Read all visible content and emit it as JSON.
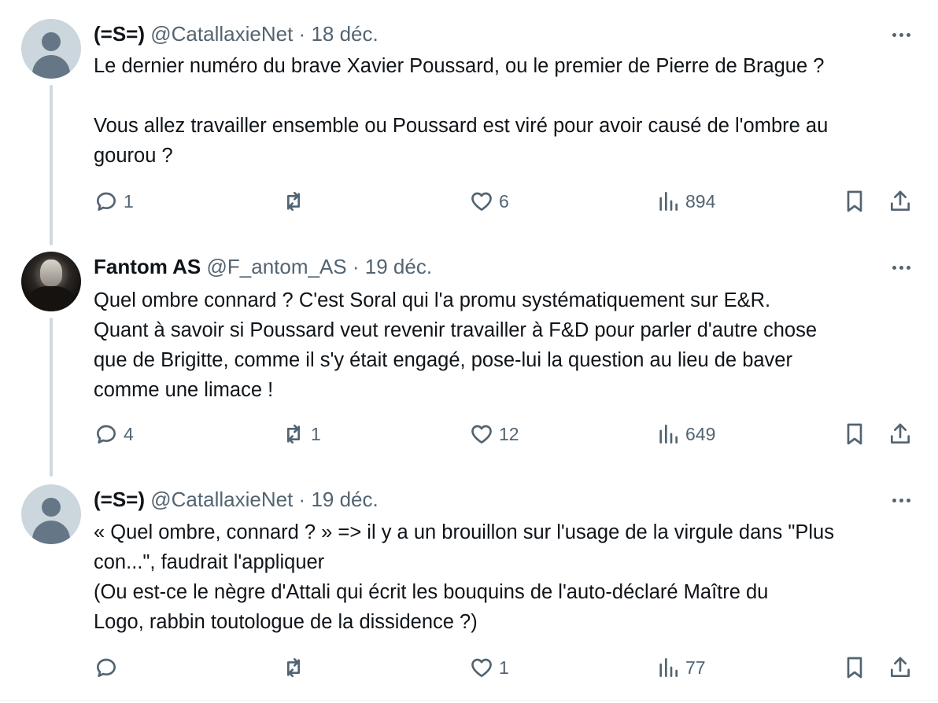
{
  "tweets": [
    {
      "name": "(=S=)",
      "handle": "@CatallaxieNet",
      "separator": "·",
      "date": "18 déc.",
      "avatar": "default-avatar",
      "paragraphs": [
        "Le dernier numéro du brave Xavier Poussard, ou le premier de Pierre de Brague ?",
        "",
        "Vous allez travailler ensemble ou Poussard est viré pour avoir causé de l'ombre au",
        "gourou ?"
      ],
      "replies": "1",
      "reposts": "",
      "likes": "6",
      "views": "894"
    },
    {
      "name": "Fantom AS",
      "handle": "@F_antom_AS",
      "separator": "·",
      "date": "19 déc.",
      "avatar": "photo-avatar",
      "paragraphs": [
        "Quel ombre connard ? C'est Soral qui l'a promu systématiquement sur E&R.",
        "Quant à savoir si Poussard veut revenir travailler à F&D pour parler d'autre chose",
        "que de Brigitte, comme il s'y était engagé, pose-lui la question au lieu de baver",
        "comme une limace !"
      ],
      "replies": "4",
      "reposts": "1",
      "likes": "12",
      "views": "649"
    },
    {
      "name": "(=S=)",
      "handle": "@CatallaxieNet",
      "separator": "·",
      "date": "19 déc.",
      "avatar": "default-avatar",
      "paragraphs": [
        "« Quel ombre, connard ? » => il y a un brouillon sur l'usage de la virgule dans \"Plus",
        "con...\", faudrait l'appliquer",
        "(Ou est-ce le nègre d'Attali qui écrit les bouquins de l'auto-déclaré Maître du",
        "Logo, rabbin toutologue de la dissidence ?)"
      ],
      "replies": "",
      "reposts": "",
      "likes": "1",
      "views": "77"
    }
  ],
  "icons": {
    "reply": "reply-icon",
    "repost": "repost-icon",
    "like": "heart-icon",
    "views": "views-icon",
    "bookmark": "bookmark-icon",
    "share": "share-icon",
    "more": "more-icon"
  },
  "colors": {
    "text": "#0f1419",
    "secondary": "#536471",
    "thread_line": "#cfd9de",
    "avatar_bg": "#ccd6dd"
  }
}
